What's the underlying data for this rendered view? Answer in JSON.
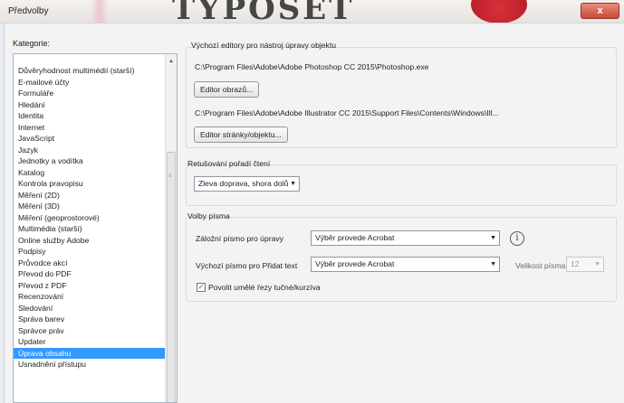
{
  "window": {
    "title": "Předvolby",
    "brand_logo_text": "TYPOSET",
    "close_label": "x"
  },
  "categories": {
    "label": "Kategorie:",
    "items": [
      "Důvěryhodnost multimédií (starší)",
      "E-mailové účty",
      "Formuláře",
      "Hledání",
      "Identita",
      "Internet",
      "JavaScript",
      "Jazyk",
      "Jednotky a vodítka",
      "Katalog",
      "Kontrola pravopisu",
      "Měření (2D)",
      "Měření (3D)",
      "Měření (geoprostorové)",
      "Multimédia (starší)",
      "Online služby Adobe",
      "Podpisy",
      "Průvodce akcí",
      "Převod do PDF",
      "Převod z PDF",
      "Recenzování",
      "Sledování",
      "Správa barev",
      "Správce práv",
      "Updater",
      "Úprava obsahu",
      "Usnadnění přístupu"
    ],
    "selected": "Úprava obsahu"
  },
  "editors": {
    "title": "Výchozí editory pro nástroj úpravy objektu",
    "image_editor_path": "C:\\Program Files\\Adobe\\Adobe Photoshop CC 2015\\Photoshop.exe",
    "image_editor_button": "Editor obrazů...",
    "page_editor_path": "C:\\Program Files\\Adobe\\Adobe Illustrator CC 2015\\Support Files\\Contents\\Windows\\Ill...",
    "page_editor_button": "Editor stránky/objektu..."
  },
  "reading_order": {
    "title": "Retušování pořadí čtení",
    "value": "Zleva doprava, shora dolů"
  },
  "font_options": {
    "title": "Volby písma",
    "fallback_font_label": "Záložní písmo pro úpravy",
    "fallback_font_value": "Výběr provede Acrobat",
    "default_font_label": "Výchozí písmo pro Přidat text",
    "default_font_value": "Výběr provede Acrobat",
    "font_size_label": "Velikost písma",
    "font_size_value": "12",
    "synthetic_styles_label": "Povolit umělé řezy tučné/kurzíva",
    "synthetic_styles_checked": true
  },
  "icons": {
    "info": "i",
    "dropdown": "▼",
    "scroll_up": "▲",
    "check": "✓",
    "grip": "≡"
  }
}
